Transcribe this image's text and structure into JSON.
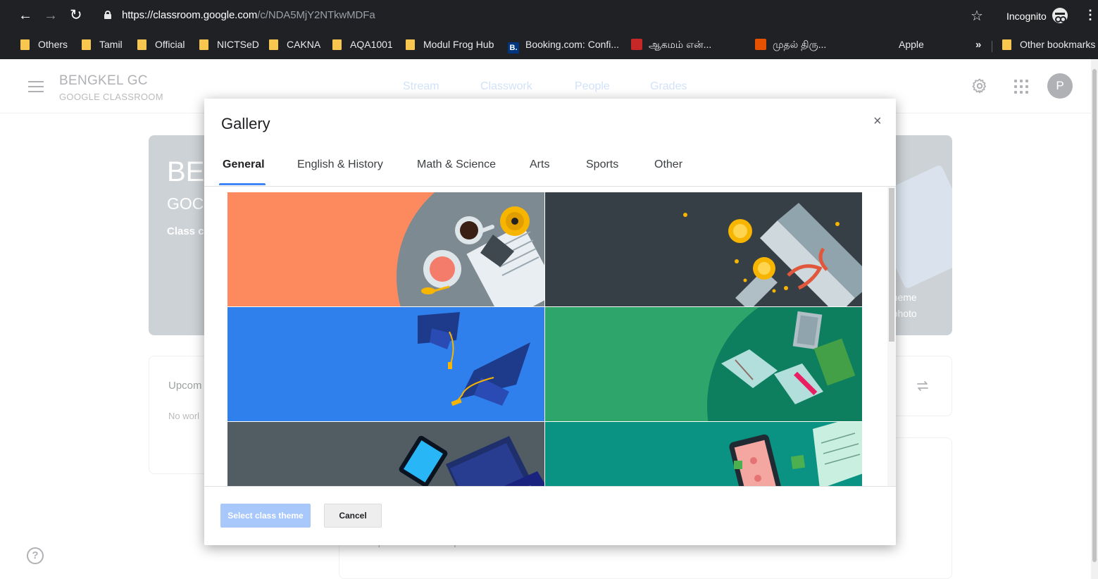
{
  "browser": {
    "url_host": "https://classroom.google.com",
    "url_path": "/c/NDA5MjY2NTkwMDFa",
    "incognito_label": "Incognito",
    "bookmarks": [
      "Others",
      "Tamil",
      "Official",
      "NICTSeD",
      "CAKNA",
      "AQA1001",
      "Modul Frog Hub",
      "Booking.com: Confi...",
      "ஆகமம் என்...",
      "முதல் திரு...",
      "Apple"
    ],
    "more_bookmarks": "»",
    "other_bookmarks": "Other bookmarks"
  },
  "header": {
    "class_name": "BENGKEL GC",
    "class_sub": "GOOGLE CLASSROOM",
    "tabs": [
      "Stream",
      "Classwork",
      "People",
      "Grades"
    ],
    "avatar_letter": "P"
  },
  "background": {
    "banner_title": "BE",
    "banner_sub": "GOC",
    "banner_code": "Class c",
    "banner_link1": "t theme",
    "banner_link2": "d photo",
    "upcoming_title": "Upcom",
    "upcoming_empty": "No worl",
    "respond_text": "Respond to student posts"
  },
  "modal": {
    "title": "Gallery",
    "close": "×",
    "tabs": [
      "General",
      "English & History",
      "Math & Science",
      "Arts",
      "Sports",
      "Other"
    ],
    "active_tab": "General",
    "themes": [
      "breakfast",
      "graduation-scroll",
      "graduation-caps",
      "books",
      "laptop",
      "phone-notes"
    ],
    "select_button": "Select class theme",
    "cancel_button": "Cancel"
  },
  "colors": {
    "chrome": "#202124",
    "accent": "#4285f4",
    "theme_orange": "#fd8a5e",
    "theme_dark": "#373f46",
    "theme_blue": "#2f80ed",
    "theme_green": "#2ea66b",
    "theme_slate": "#515c63",
    "theme_teal": "#0a9282"
  }
}
